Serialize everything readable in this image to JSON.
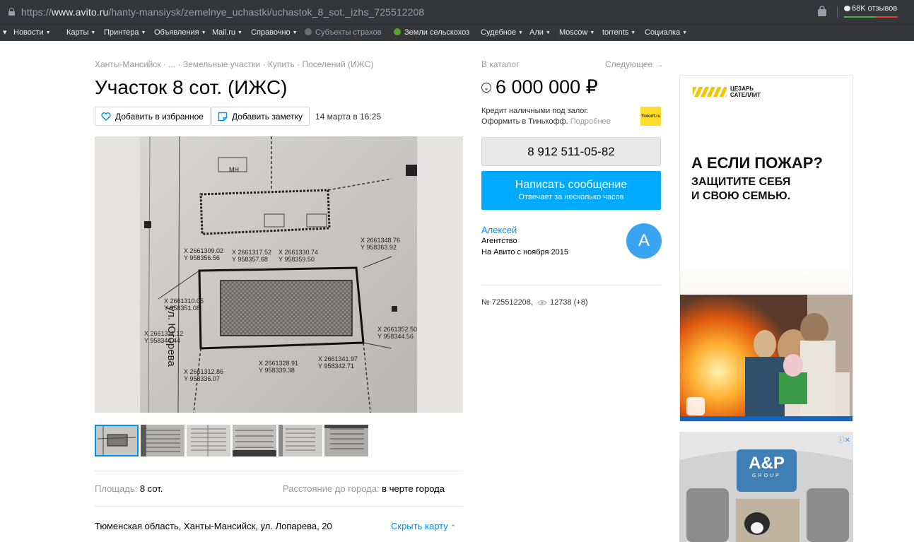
{
  "browser": {
    "url_scheme": "https://",
    "url_host": "www.avito.ru",
    "url_path": "/hanty-mansiysk/zemelnye_uchastki/uchastok_8_sot._izhs_725512208",
    "reviews_label": "68K отзывов"
  },
  "bookmarks": [
    "Новости",
    "Карты",
    "Принтера",
    "Объявления",
    "Mail.ru",
    "Справочно",
    "Субъекты страхов",
    "Земли сельскохоз",
    "Судебное",
    "Али",
    "Moscow",
    "torrents",
    "Социалка"
  ],
  "page": {
    "breadcrumbs": "Ханты-Мансийск · ... · Земельные участки · Купить · Поселений (ИЖС)",
    "title": "Участок 8 сот. (ИЖС)",
    "favorite_label": "Добавить в избранное",
    "note_label": "Добавить заметку",
    "date": "14 марта в 16:25",
    "params": {
      "area_key": "Площадь:",
      "area_value": "8 сот.",
      "distance_key": "Расстояние до города:",
      "distance_value": "в черте города"
    },
    "address": "Тюменская область, Ханты-Мансийск, ул. Лопарева, 20",
    "hide_map": "Скрыть карту"
  },
  "sidebar": {
    "catalog": "В каталог",
    "next": "Следующее →",
    "price": "6 000 000 ₽",
    "credit_line1": "Кредит наличными под залог.",
    "credit_line2": "Оформить в Тинькофф.",
    "credit_more": "Подробнее",
    "tinkoff_logo": "Tinkoff.ru",
    "phone": "8 912 511-05-82",
    "message_title": "Написать сообщение",
    "message_sub": "Отвечает за несколько часов",
    "seller_name": "Алексей",
    "seller_type": "Агентство",
    "seller_since": "На Авито с ноября 2015",
    "seller_initial": "A",
    "ad_number": "№ 725512208,",
    "views": "12738 (+8)"
  },
  "ads": {
    "ad1_brand_line1": "ЦЕЗАРЬ",
    "ad1_brand_line2": "САТЕЛЛИТ",
    "ad1_headline": "А ЕСЛИ ПОЖАР?",
    "ad1_sub_line1": "ЗАЩИТИТЕ СЕБЯ",
    "ad1_sub_line2": "И СВОЮ СЕМЬЮ.",
    "ad2_logo": "A&P",
    "ad2_logo_sub": "GROUP"
  },
  "plan_labels": [
    "X 2661309.02",
    "Y 958356.56",
    "X 2661317.52",
    "Y 958357.68",
    "X 2661330.74",
    "Y 958359.50",
    "X 2661348.76",
    "Y 958363.92",
    "X 2661310.05",
    "Y 958351.08",
    "X 2661311.12",
    "Y 958344.44",
    "X 2661352.50",
    "Y 958344.56",
    "X 2661328.91",
    "Y 958339.38",
    "X 2661341.97",
    "Y 958342.71",
    "X 2661312.86",
    "Y 958336.07",
    "ул. Югорева",
    "МН"
  ],
  "colors": {
    "accent": "#0091ea",
    "message_button": "#00aaff",
    "avatar": "#3ba4f2",
    "tinkoff": "#ffdd2d"
  }
}
